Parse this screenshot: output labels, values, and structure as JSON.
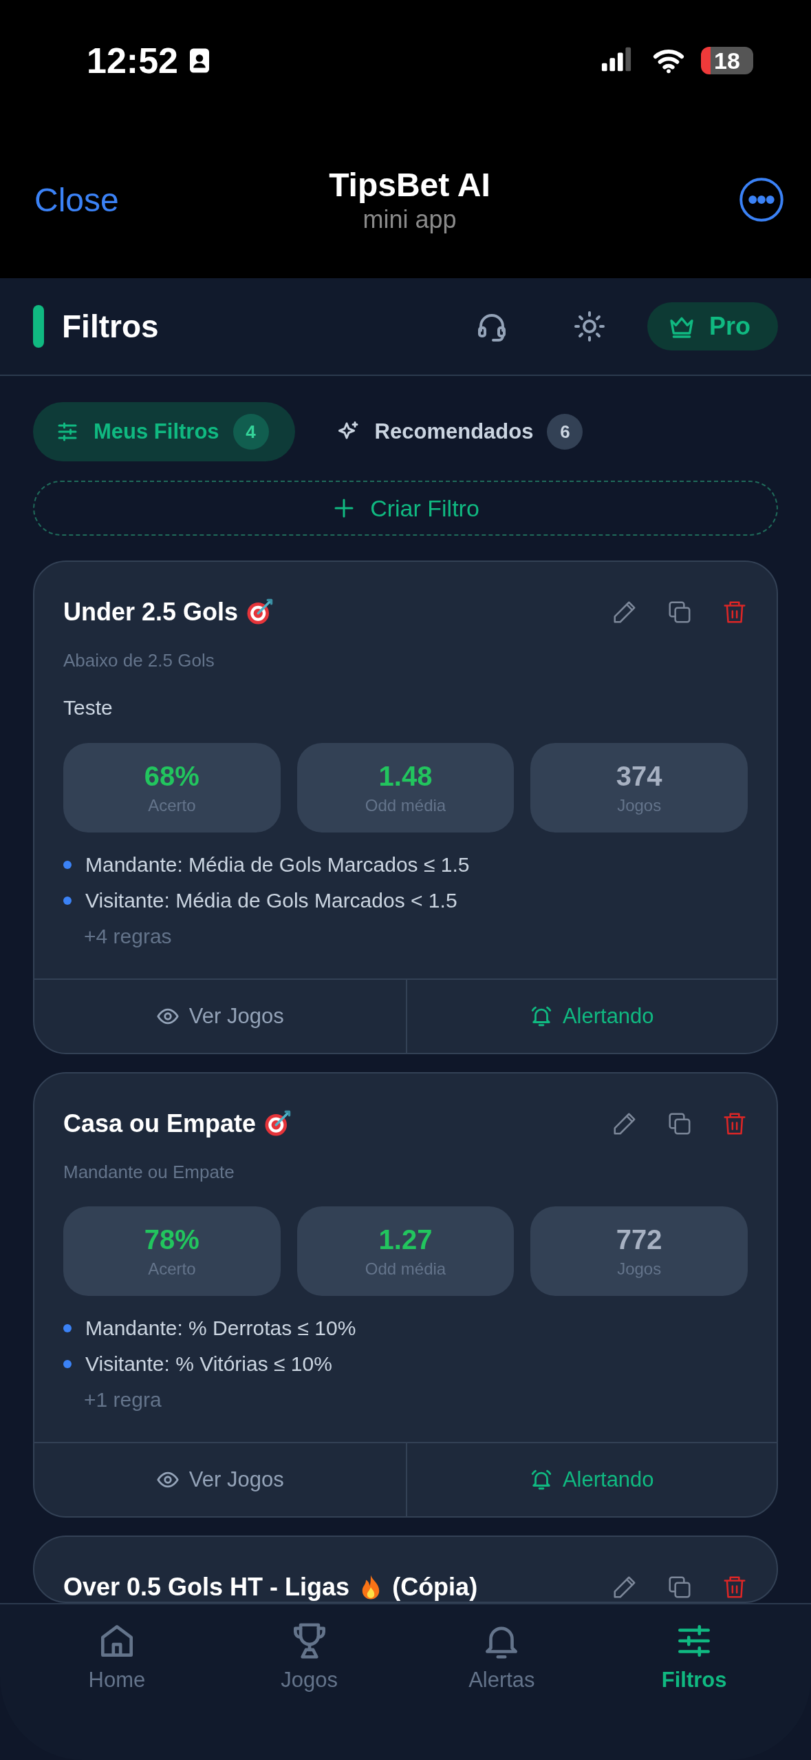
{
  "status_bar": {
    "time": "12:52",
    "battery": "18"
  },
  "header": {
    "close": "Close",
    "title": "TipsBet AI",
    "subtitle": "mini app"
  },
  "page": {
    "title": "Filtros",
    "pro": "Pro"
  },
  "tabs": [
    {
      "label": "Meus Filtros",
      "count": "4",
      "selected": true
    },
    {
      "label": "Recomendados",
      "count": "6",
      "selected": false
    }
  ],
  "create_button": "Criar Filtro",
  "filters": [
    {
      "title": "Under 2.5 Gols",
      "kind": "target",
      "subtitle": "Abaixo de 2.5 Gols",
      "description": "Teste",
      "stats": [
        {
          "value": "68%",
          "label": "Acerto"
        },
        {
          "value": "1.48",
          "label": "Odd média"
        },
        {
          "value": "374",
          "label": "Jogos"
        }
      ],
      "rules": [
        "Mandante: Média de Gols Marcados ≤ 1.5",
        "Visitante: Média de Gols Marcados < 1.5"
      ],
      "more_rules": "+4 regras",
      "view": "Ver Jogos",
      "alert": "Alertando",
      "alert_on": true
    },
    {
      "title": "Casa ou Empate",
      "kind": "target",
      "subtitle": "Mandante ou Empate",
      "stats": [
        {
          "value": "78%",
          "label": "Acerto"
        },
        {
          "value": "1.27",
          "label": "Odd média"
        },
        {
          "value": "772",
          "label": "Jogos"
        }
      ],
      "rules": [
        "Mandante: % Derrotas ≤ 10%",
        "Visitante: % Vitórias ≤ 10%"
      ],
      "more_rules": "+1 regra",
      "view": "Ver Jogos",
      "alert": "Alertando",
      "alert_on": true
    },
    {
      "title": "Over 0.5 Gols HT - Ligas",
      "kind": "fire",
      "title_suffix": "(Cópia)"
    }
  ],
  "nav": [
    {
      "label": "Home",
      "selected": false
    },
    {
      "label": "Jogos",
      "selected": false
    },
    {
      "label": "Alertas",
      "selected": false
    },
    {
      "label": "Filtros",
      "selected": true
    }
  ]
}
